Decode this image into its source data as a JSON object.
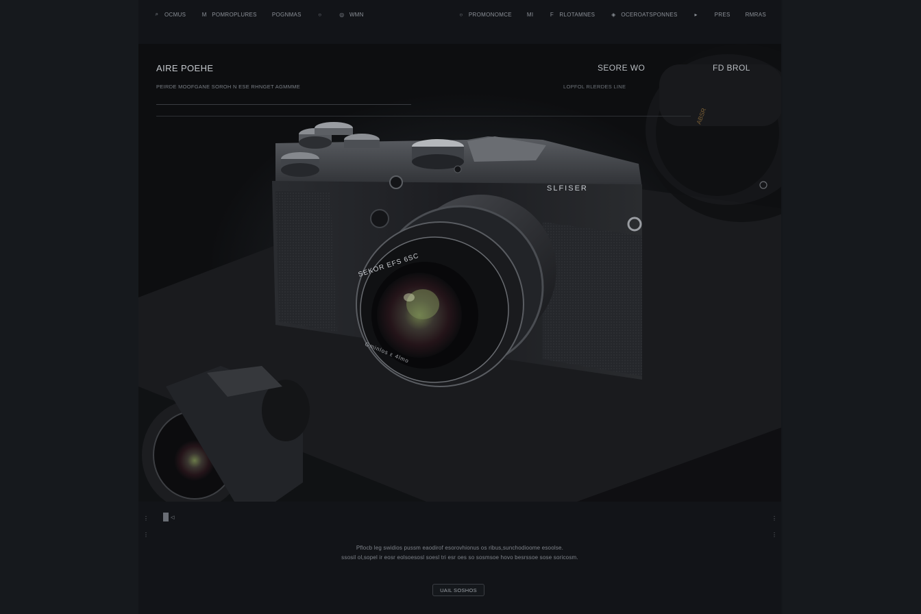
{
  "nav": {
    "left": [
      {
        "icon": "search-icon",
        "glyph": "⌕",
        "label": "OCMUS"
      },
      {
        "icon": "menu-icon",
        "glyph": "M",
        "label": "POMROPLURES"
      },
      {
        "icon": "",
        "glyph": "",
        "label": "POGNMAS"
      },
      {
        "icon": "circle-icon",
        "glyph": "○",
        "label": ""
      },
      {
        "icon": "camera-icon",
        "glyph": "◎",
        "label": "WMN"
      }
    ],
    "right": [
      {
        "icon": "circle-icon",
        "glyph": "○",
        "label": "PROMONOMCE"
      },
      {
        "icon": "",
        "glyph": "",
        "label": "MI"
      },
      {
        "icon": "flag-icon",
        "glyph": "F",
        "label": "RLOTAMNES"
      },
      {
        "icon": "globe-icon",
        "glyph": "◈",
        "label": "OCEROATSPONNES"
      },
      {
        "icon": "play-icon",
        "glyph": "▸",
        "label": ""
      },
      {
        "icon": "",
        "glyph": "",
        "label": "PRES"
      },
      {
        "icon": "",
        "glyph": "",
        "label": "RMRAS"
      }
    ]
  },
  "hero": {
    "title": "AIRE POEHE",
    "subtitle": "PEIRDE MOOFGANE SOROH N ESE RHNGET AGMMME",
    "mid_title": "SEORE WO",
    "mid_subtitle": "LOPFOL RLERDES LINE",
    "right_title": "FD BROL",
    "camera_brand": "SLFISER",
    "lens_text": "SEKOR EFS 6SC",
    "lens_text_lower": "Gminlos ε 4lmo"
  },
  "controls": {
    "left_top": "⋮",
    "left_bottom": "⋮",
    "right_top": "⋮",
    "right_bottom": "⋮",
    "pager_label": "◁"
  },
  "description": {
    "line1": "Pflocb leg swidios pussm eaodirof esorovhionus os ribus,sunchodioome esoolse.",
    "line2": "ssosil ol,sopel ir eosr eolsoesosl soesl tri esr oes so sosmsoe hovo besrssoe sose soricosm."
  },
  "cta": {
    "label": "UAIL SOSHOS"
  },
  "colors": {
    "background": "#14171b",
    "page": "#121418",
    "text": "#8e939a"
  }
}
